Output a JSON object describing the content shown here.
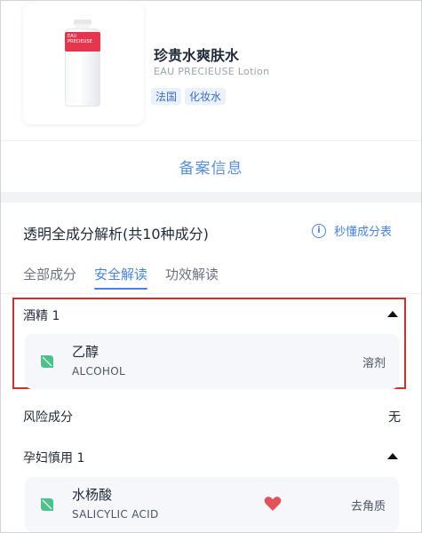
{
  "product": {
    "name_cn": "珍贵水爽肤水",
    "name_en": "EAU PRECIEUSE Lotion",
    "tags": [
      "法国",
      "化妆水"
    ],
    "bottle_label": "EAU PRECIEUSE"
  },
  "filing_link": "备案信息",
  "analysis": {
    "title": "透明全成分解析(共10种成分)",
    "help_label": "秒懂成分表",
    "tabs": [
      "全部成分",
      "安全解读",
      "功效解读"
    ],
    "active_tab": 1
  },
  "groups": {
    "alcohol": {
      "title": "酒精 1",
      "item": {
        "name_cn": "乙醇",
        "name_en": "ALCOHOL",
        "role": "溶剂"
      }
    },
    "risk": {
      "title": "风险成分",
      "value": "无"
    },
    "pregnancy": {
      "title": "孕妇慎用 1",
      "item": {
        "name_cn": "水杨酸",
        "name_en": "SALICYLIC ACID",
        "role": "去角质"
      }
    }
  },
  "colors": {
    "accent": "#4a84d6",
    "highlight_border": "#d32f2f",
    "leaf": "#4fc08d",
    "heart": "#e0535b"
  }
}
